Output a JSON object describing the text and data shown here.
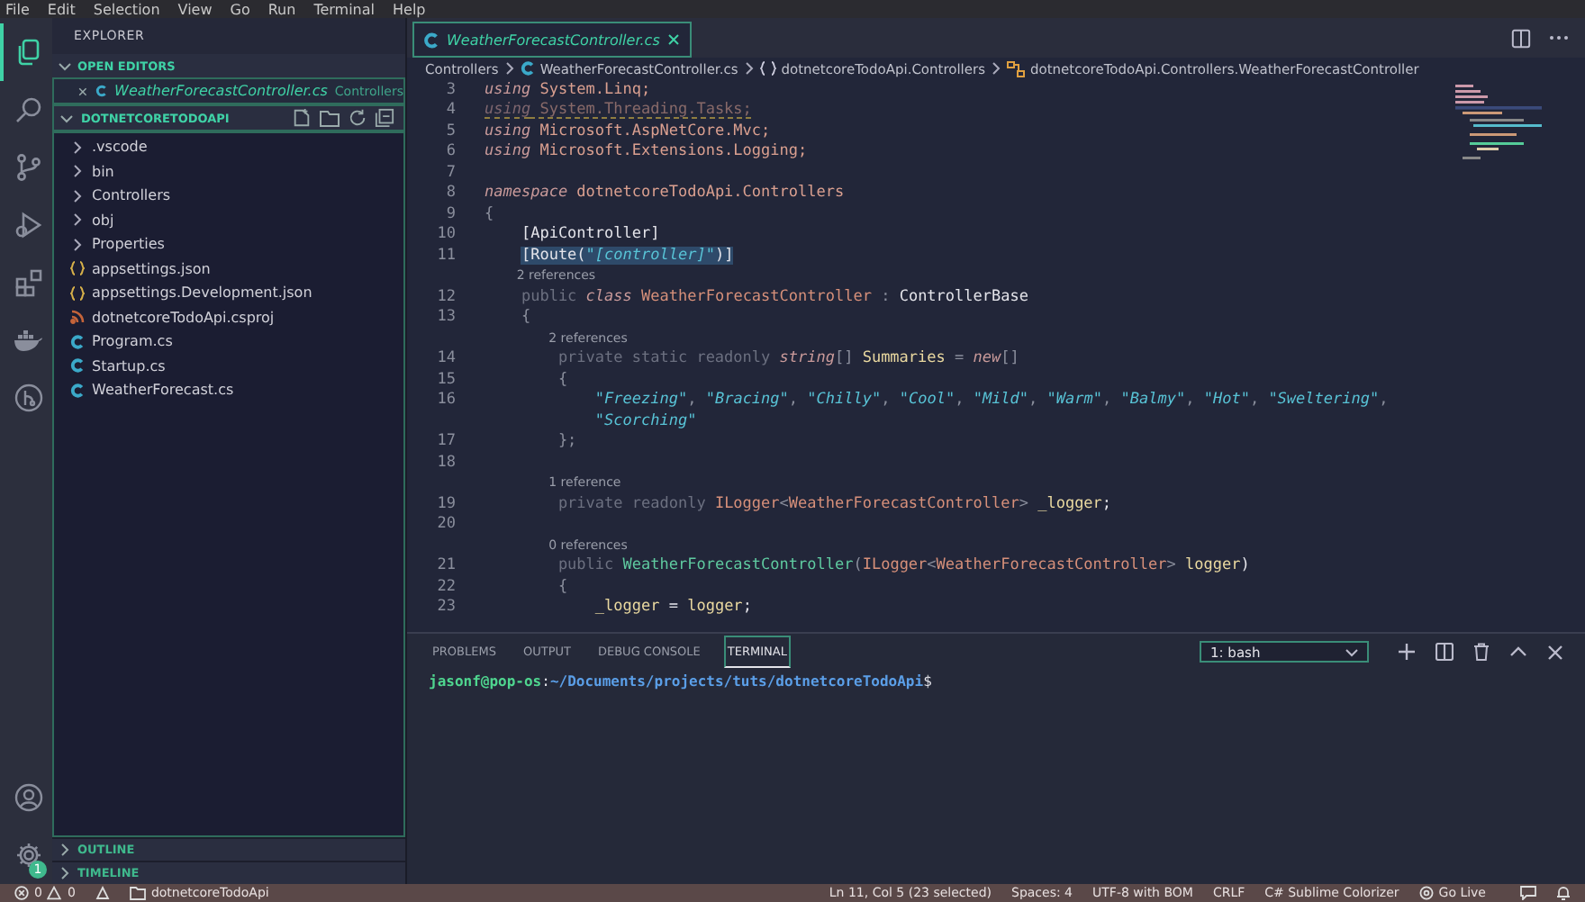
{
  "menu_bar": [
    "File",
    "Edit",
    "Selection",
    "View",
    "Go",
    "Run",
    "Terminal",
    "Help"
  ],
  "activity_bar": {
    "items": [
      {
        "kind": "files",
        "selected": true
      },
      {
        "kind": "search",
        "selected": false
      },
      {
        "kind": "source-control",
        "selected": false
      },
      {
        "kind": "run",
        "selected": false
      },
      {
        "kind": "extensions",
        "selected": false
      },
      {
        "kind": "docker",
        "selected": false
      },
      {
        "kind": "git-graph",
        "selected": false
      }
    ],
    "settings_badge": "1"
  },
  "sidebar": {
    "title": "EXPLORER",
    "open_editors": {
      "title": "OPEN EDITORS",
      "expanded": true,
      "items": [
        {
          "name": "WeatherForecastController.cs",
          "folder": "Controllers"
        }
      ]
    },
    "project": {
      "title": "DOTNETCORETODOAPI",
      "expanded": true,
      "items": [
        {
          "kind": "folder",
          "name": ".vscode",
          "expanded": false
        },
        {
          "kind": "folder",
          "name": "bin",
          "expanded": false
        },
        {
          "kind": "folder",
          "name": "Controllers",
          "expanded": false
        },
        {
          "kind": "folder",
          "name": "obj",
          "expanded": false
        },
        {
          "kind": "folder",
          "name": "Properties",
          "expanded": false
        },
        {
          "kind": "json",
          "name": "appsettings.json"
        },
        {
          "kind": "json",
          "name": "appsettings.Development.json"
        },
        {
          "kind": "csproj",
          "name": "dotnetcoreTodoApi.csproj"
        },
        {
          "kind": "cs",
          "name": "Program.cs"
        },
        {
          "kind": "cs",
          "name": "Startup.cs"
        },
        {
          "kind": "cs",
          "name": "WeatherForecast.cs"
        }
      ]
    },
    "sections": [
      {
        "title": "OUTLINE",
        "expanded": false
      },
      {
        "title": "TIMELINE",
        "expanded": false
      }
    ]
  },
  "editor": {
    "tabs": [
      {
        "name": "WeatherForecastController.cs",
        "selected": true
      }
    ],
    "breadcrumbs": [
      {
        "kind": "folder",
        "text": "Controllers"
      },
      {
        "kind": "cs",
        "text": "WeatherForecastController.cs"
      },
      {
        "kind": "namespace",
        "text": "dotnetcoreTodoApi.Controllers"
      },
      {
        "kind": "class",
        "text": "dotnetcoreTodoApi.Controllers.WeatherForecastController"
      }
    ],
    "lines": [
      {
        "kind": "code",
        "number": "3",
        "selected": false,
        "unused": false,
        "tokens": [
          {
            "text": "using",
            "kind": "kw"
          },
          {
            "text": " System.Linq;",
            "kind": "id"
          }
        ]
      },
      {
        "kind": "code",
        "number": "4",
        "selected": false,
        "unused": true,
        "tokens": [
          {
            "text": "using",
            "kind": "kw"
          },
          {
            "text": " System.Threading.Tasks;",
            "kind": "id"
          }
        ]
      },
      {
        "kind": "code",
        "number": "5",
        "selected": false,
        "unused": false,
        "tokens": [
          {
            "text": "using",
            "kind": "kw"
          },
          {
            "text": " Microsoft.AspNetCore.Mvc;",
            "kind": "id"
          }
        ]
      },
      {
        "kind": "code",
        "number": "6",
        "selected": false,
        "unused": false,
        "tokens": [
          {
            "text": "using",
            "kind": "kw"
          },
          {
            "text": " Microsoft.Extensions.Logging;",
            "kind": "id"
          }
        ]
      },
      {
        "kind": "blank",
        "number": "7"
      },
      {
        "kind": "code",
        "number": "8",
        "selected": false,
        "unused": false,
        "tokens": [
          {
            "text": "namespace",
            "kind": "kw"
          },
          {
            "text": " dotnetcoreTodoApi.Controllers",
            "kind": "id"
          }
        ]
      },
      {
        "kind": "code",
        "number": "9",
        "selected": false,
        "unused": false,
        "tokens": [
          {
            "text": "{",
            "kind": "punct"
          }
        ]
      },
      {
        "kind": "block",
        "children": [
          {
            "kind": "code",
            "number": "10",
            "selected": false,
            "unused": false,
            "tokens": [
              {
                "text": "[ApiController]",
                "kind": "plain"
              }
            ]
          },
          {
            "kind": "code",
            "number": "11",
            "selected": true,
            "unused": false,
            "tokens": [
              {
                "text": "[Route(",
                "kind": "plain"
              },
              {
                "text": "\"[controller]\"",
                "kind": "str"
              },
              {
                "text": ")]",
                "kind": "plain"
              }
            ]
          },
          {
            "kind": "lens",
            "text": "2 references"
          },
          {
            "kind": "code",
            "number": "12",
            "selected": false,
            "unused": false,
            "tokens": [
              {
                "text": "public",
                "kind": "dim"
              },
              {
                "text": " class",
                "kind": "kw"
              },
              {
                "text": " WeatherForecastController",
                "kind": "type"
              },
              {
                "text": " : ",
                "kind": "punct"
              },
              {
                "text": "ControllerBase",
                "kind": "plain"
              }
            ]
          },
          {
            "kind": "code",
            "number": "13",
            "selected": false,
            "unused": false,
            "tokens": [
              {
                "text": "{",
                "kind": "punct"
              }
            ]
          },
          {
            "kind": "block",
            "children": [
              {
                "kind": "lens",
                "text": "2 references"
              },
              {
                "kind": "code",
                "number": "14",
                "selected": false,
                "unused": false,
                "tokens": [
                  {
                    "text": "private static readonly",
                    "kind": "dim"
                  },
                  {
                    "text": " string",
                    "kind": "kw"
                  },
                  {
                    "text": "[] ",
                    "kind": "punct"
                  },
                  {
                    "text": "Summaries",
                    "kind": "var"
                  },
                  {
                    "text": " = ",
                    "kind": "punct"
                  },
                  {
                    "text": "new",
                    "kind": "kw"
                  },
                  {
                    "text": "[]",
                    "kind": "punct"
                  }
                ]
              },
              {
                "kind": "code",
                "number": "15",
                "selected": false,
                "unused": false,
                "tokens": [
                  {
                    "text": "{",
                    "kind": "punct"
                  }
                ]
              },
              {
                "kind": "block",
                "children": [
                  {
                    "kind": "code",
                    "number": "16",
                    "selected": false,
                    "unused": false,
                    "tokens": [
                      {
                        "text": "\"Freezing\"",
                        "kind": "str"
                      },
                      {
                        "text": ", ",
                        "kind": "punct"
                      },
                      {
                        "text": "\"Bracing\"",
                        "kind": "str"
                      },
                      {
                        "text": ", ",
                        "kind": "punct"
                      },
                      {
                        "text": "\"Chilly\"",
                        "kind": "str"
                      },
                      {
                        "text": ", ",
                        "kind": "punct"
                      },
                      {
                        "text": "\"Cool\"",
                        "kind": "str"
                      },
                      {
                        "text": ", ",
                        "kind": "punct"
                      },
                      {
                        "text": "\"Mild\"",
                        "kind": "str"
                      },
                      {
                        "text": ", ",
                        "kind": "punct"
                      },
                      {
                        "text": "\"Warm\"",
                        "kind": "str"
                      },
                      {
                        "text": ", ",
                        "kind": "punct"
                      },
                      {
                        "text": "\"Balmy\"",
                        "kind": "str"
                      },
                      {
                        "text": ", ",
                        "kind": "punct"
                      },
                      {
                        "text": "\"Hot\"",
                        "kind": "str"
                      },
                      {
                        "text": ", ",
                        "kind": "punct"
                      },
                      {
                        "text": "\"Sweltering\"",
                        "kind": "str"
                      },
                      {
                        "text": ",",
                        "kind": "punct"
                      }
                    ]
                  },
                  {
                    "kind": "code",
                    "selected": false,
                    "unused": false,
                    "tokens": [
                      {
                        "text": "\"Scorching\"",
                        "kind": "str"
                      }
                    ]
                  }
                ]
              },
              {
                "kind": "code",
                "number": "17",
                "selected": false,
                "unused": false,
                "tokens": [
                  {
                    "text": "};",
                    "kind": "punct"
                  }
                ]
              },
              {
                "kind": "blank",
                "number": "18"
              },
              {
                "kind": "lens",
                "text": "1 reference"
              },
              {
                "kind": "code",
                "number": "19",
                "selected": false,
                "unused": false,
                "tokens": [
                  {
                    "text": "private readonly",
                    "kind": "dim"
                  },
                  {
                    "text": " ILogger",
                    "kind": "type"
                  },
                  {
                    "text": "<",
                    "kind": "punct"
                  },
                  {
                    "text": "WeatherForecastController",
                    "kind": "type"
                  },
                  {
                    "text": "> ",
                    "kind": "punct"
                  },
                  {
                    "text": "_logger",
                    "kind": "var"
                  },
                  {
                    "text": ";",
                    "kind": "plain"
                  }
                ]
              },
              {
                "kind": "blank",
                "number": "20"
              },
              {
                "kind": "lens",
                "text": "0 references"
              },
              {
                "kind": "code",
                "number": "21",
                "selected": false,
                "unused": false,
                "tokens": [
                  {
                    "text": "public",
                    "kind": "dim"
                  },
                  {
                    "text": " WeatherForecastController",
                    "kind": "fn"
                  },
                  {
                    "text": "(",
                    "kind": "punct"
                  },
                  {
                    "text": "ILogger",
                    "kind": "type"
                  },
                  {
                    "text": "<",
                    "kind": "punct"
                  },
                  {
                    "text": "WeatherForecastController",
                    "kind": "type"
                  },
                  {
                    "text": "> ",
                    "kind": "punct"
                  },
                  {
                    "text": "logger",
                    "kind": "var"
                  },
                  {
                    "text": ")",
                    "kind": "plain"
                  }
                ]
              },
              {
                "kind": "code",
                "number": "22",
                "selected": false,
                "unused": false,
                "tokens": [
                  {
                    "text": "{",
                    "kind": "punct"
                  }
                ]
              },
              {
                "kind": "block",
                "children": [
                  {
                    "kind": "code",
                    "number": "23",
                    "selected": false,
                    "unused": false,
                    "tokens": [
                      {
                        "text": "_logger",
                        "kind": "var"
                      },
                      {
                        "text": " = ",
                        "kind": "plain"
                      },
                      {
                        "text": "logger",
                        "kind": "var"
                      },
                      {
                        "text": ";",
                        "kind": "plain"
                      }
                    ]
                  }
                ]
              }
            ]
          }
        ]
      }
    ]
  },
  "panel": {
    "tabs": [
      {
        "label": "PROBLEMS",
        "selected": false
      },
      {
        "label": "OUTPUT",
        "selected": false
      },
      {
        "label": "DEBUG CONSOLE",
        "selected": false
      },
      {
        "label": "TERMINAL",
        "selected": true
      }
    ],
    "terminal_select": "1: bash",
    "prompt": [
      {
        "text": "jasonf@pop-os",
        "kind": "user"
      },
      {
        "text": ":",
        "kind": "plain"
      },
      {
        "text": "~/Documents/projects/tuts/dotnetcoreTodoApi",
        "kind": "path"
      },
      {
        "text": "$",
        "kind": "plain"
      }
    ]
  },
  "status_bar": {
    "errors": "0",
    "warnings": "0",
    "folder": "dotnetcoreTodoApi",
    "right": [
      "Ln 11, Col 5 (23 selected)",
      "Spaces: 4",
      "UTF-8 with BOM",
      "CRLF",
      "C# Sublime Colorizer"
    ],
    "go_live": "Go Live"
  }
}
